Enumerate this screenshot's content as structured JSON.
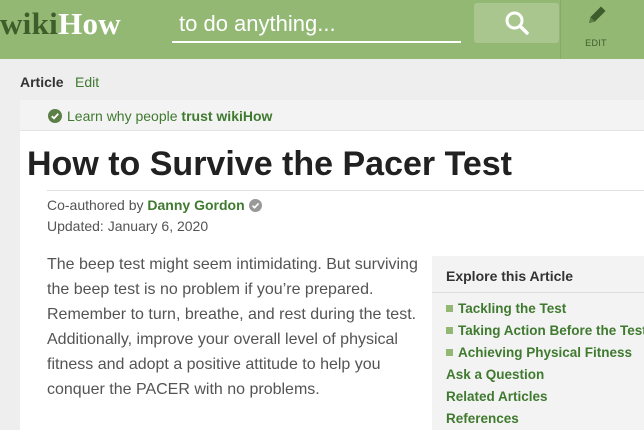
{
  "header": {
    "logo_wiki": "wiki",
    "logo_how": "How",
    "search_placeholder": "to do anything...",
    "edit_label": "EDIT"
  },
  "tabs": [
    {
      "label": "Article",
      "active": true
    },
    {
      "label": "Edit",
      "active": false
    }
  ],
  "trust": {
    "prefix": "Learn why people",
    "link": "trust wikiHow"
  },
  "article": {
    "title": "How to Survive the Pacer Test",
    "coauthored_prefix": "Co-authored by",
    "author": "Danny Gordon",
    "updated": "Updated: January 6, 2020",
    "intro": "The beep test might seem intimidating. But surviving the beep test is no problem if you’re prepared. Remember to turn, breathe, and rest during the test. Additionally, improve your overall level of physical fitness and adopt a positive attitude to help you conquer the PACER with no problems."
  },
  "explore": {
    "title": "Explore this Article",
    "sections": [
      "Tackling the Test",
      "Taking Action Before the Test",
      "Achieving Physical Fitness"
    ],
    "links": [
      "Ask a Question",
      "Related Articles",
      "References"
    ]
  },
  "colors": {
    "header_green": "#93b874",
    "link_green": "#3f7a2f",
    "dark_green": "#3d5d2a"
  },
  "icons": {
    "search": "magnifier-icon",
    "edit": "pencil-icon",
    "trust": "check-badge-icon",
    "author_verified": "check-badge-icon"
  }
}
